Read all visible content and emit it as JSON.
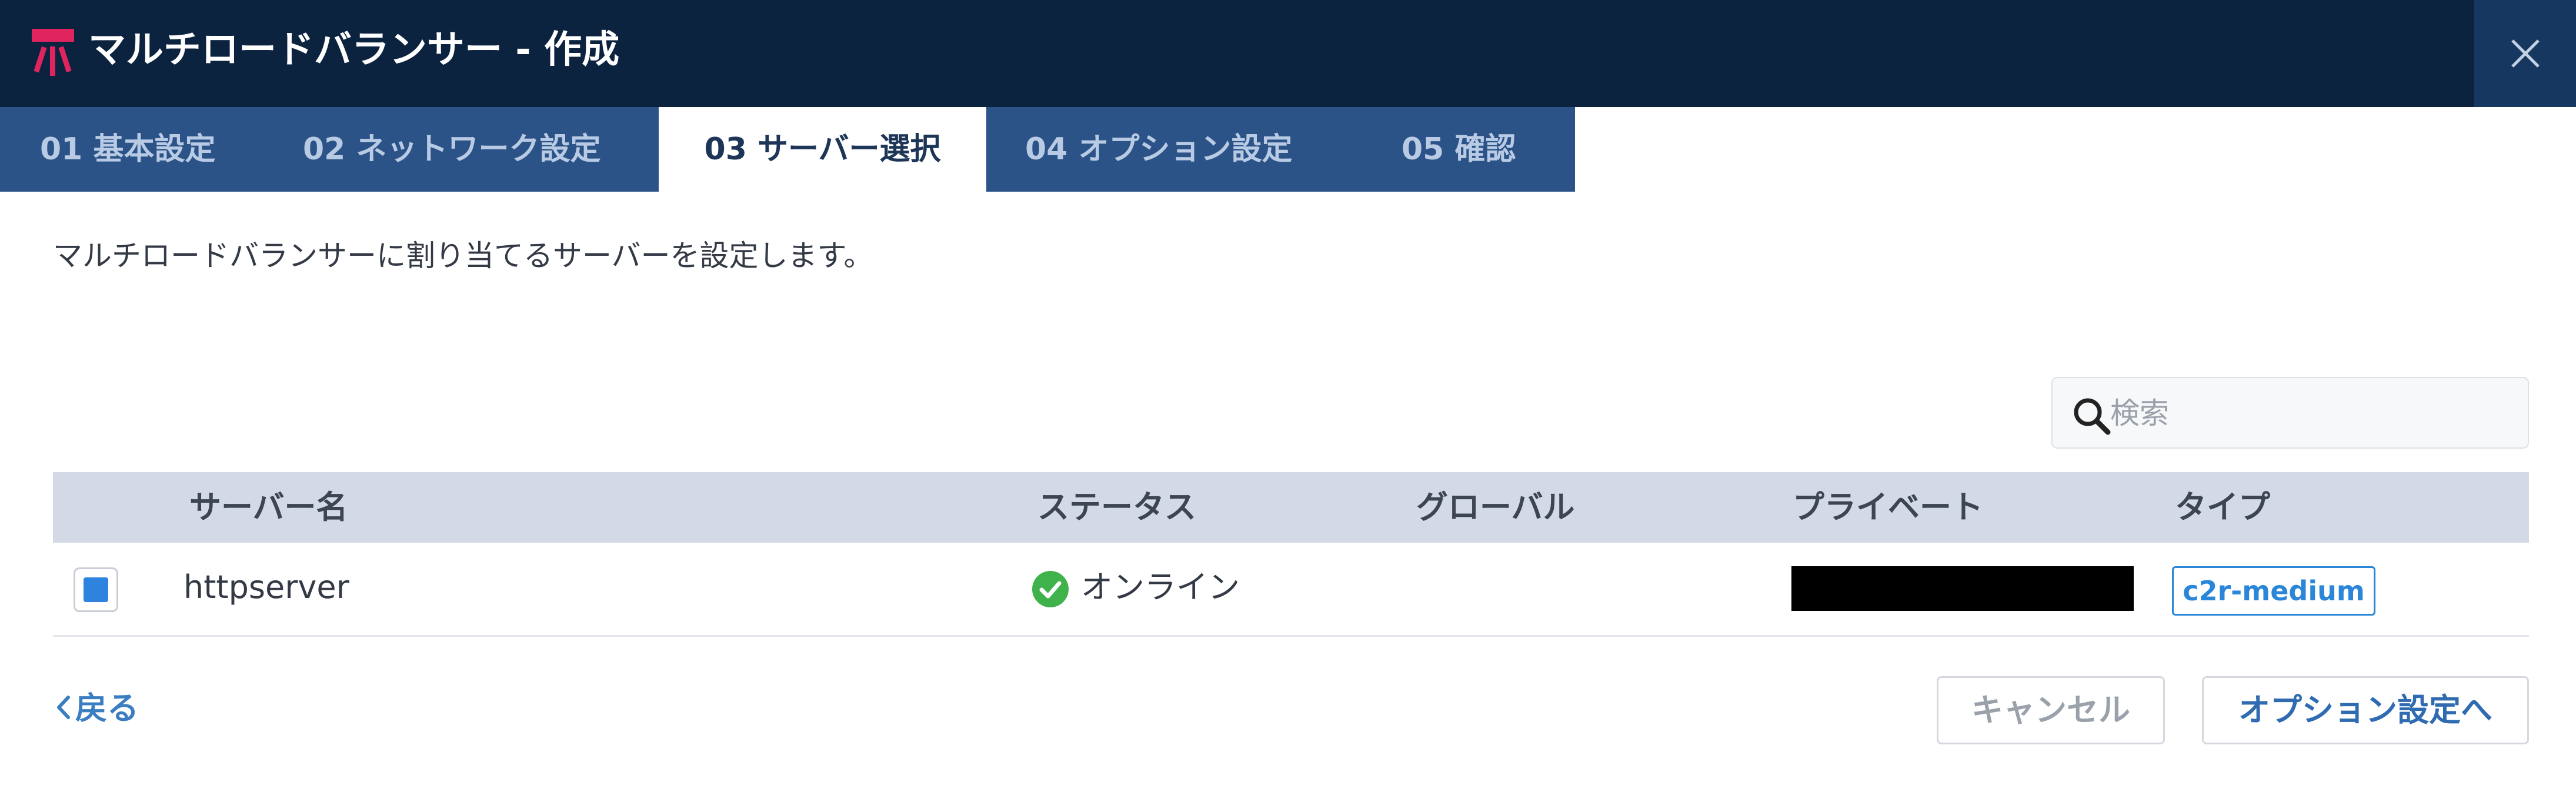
{
  "window": {
    "title": "マルチロードバランサー - 作成",
    "close_icon": "close-icon"
  },
  "tabs": [
    {
      "label": "01 基本設定",
      "active": false
    },
    {
      "label": "02 ネットワーク設定",
      "active": false
    },
    {
      "label": "03 サーバー選択",
      "active": true
    },
    {
      "label": "04 オプション設定",
      "active": false
    },
    {
      "label": "05 確認",
      "active": false
    }
  ],
  "description": "マルチロードバランサーに割り当てるサーバーを設定します。",
  "search": {
    "placeholder": "検索",
    "value": "",
    "icon": "search-icon"
  },
  "table": {
    "columns": [
      "サーバー名",
      "ステータス",
      "グローバル",
      "プライベート",
      "タイプ"
    ],
    "rows": [
      {
        "selected": true,
        "name": "httpserver",
        "status": "オンライン",
        "status_icon": "check-circle-icon",
        "global": "",
        "private": "",
        "type": "c2r-medium"
      }
    ]
  },
  "footer": {
    "back_label": "戻る",
    "cancel_label": "キャンセル",
    "next_label": "オプション設定へ"
  },
  "colors": {
    "titlebar": "#0c2340",
    "tabbar": "#2b5387",
    "accent": "#2a86d8",
    "status_ok": "#3fb24c",
    "logo": "#e0245e"
  }
}
